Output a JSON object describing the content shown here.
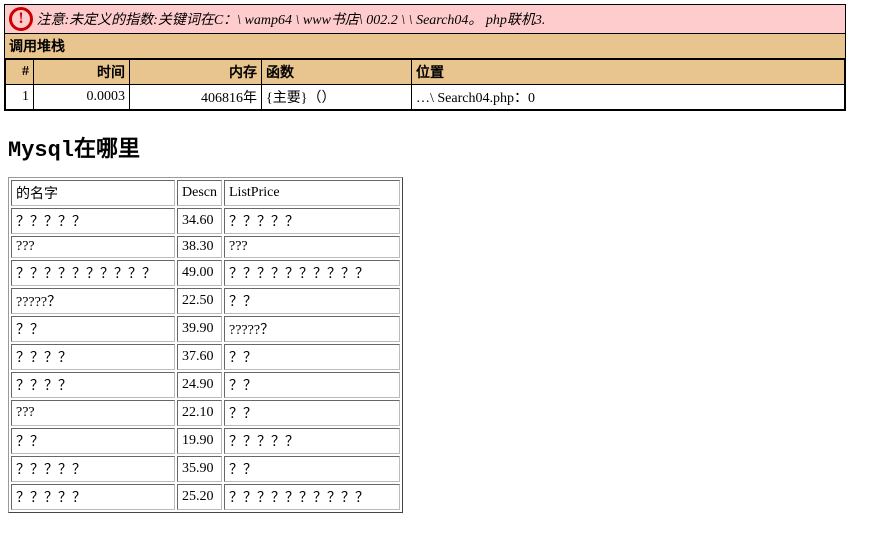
{
  "error": {
    "icon_label": "!",
    "message": "注意:未定义的指数:关键词在C：\\ wamp64 \\ www书店\\ 002.2 \\ \\ Search04。 php联机3.",
    "stack_title": "调用堆栈",
    "headers": {
      "num": "#",
      "time": "时间",
      "mem": "内存",
      "func": "函数",
      "loc": "位置"
    },
    "rows": [
      {
        "num": "1",
        "time": "0.0003",
        "mem": "406816年",
        "func": "{主要}（）",
        "loc": "…\\ Search04.php：0"
      }
    ]
  },
  "title": "Mysql在哪里",
  "result": {
    "headers": {
      "name": "的名字",
      "descn": "Descn",
      "listprice": "ListPrice"
    },
    "rows": [
      {
        "name": "？？？？？",
        "descn": "34.60",
        "listprice": "？？？？？"
      },
      {
        "name": "???",
        "descn": "38.30",
        "listprice": "???"
      },
      {
        "name": "？？？？？？？？？？",
        "descn": "49.00",
        "listprice": "？？？？？？？？？？"
      },
      {
        "name": "?????？",
        "descn": "22.50",
        "listprice": "？？"
      },
      {
        "name": "？？",
        "descn": "39.90",
        "listprice": "?????？"
      },
      {
        "name": "？？？？",
        "descn": "37.60",
        "listprice": "？？"
      },
      {
        "name": "？？？？",
        "descn": "24.90",
        "listprice": "？？"
      },
      {
        "name": "???",
        "descn": "22.10",
        "listprice": "？？"
      },
      {
        "name": "？？",
        "descn": "19.90",
        "listprice": "？？？？？"
      },
      {
        "name": "？？？？？",
        "descn": "35.90",
        "listprice": "？？"
      },
      {
        "name": "？？？？？",
        "descn": "25.20",
        "listprice": "？？？？？？？？？？"
      }
    ]
  }
}
